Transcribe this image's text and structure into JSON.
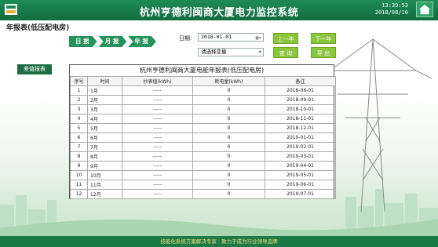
{
  "header": {
    "title": "杭州亨德利闽商大厦电力监控系统",
    "time": "13:39:53",
    "date": "2018/08/10"
  },
  "page_title": "年报表(低压配电房)",
  "nav_tabs": [
    "日 报",
    "月 报",
    "年 报"
  ],
  "filters": {
    "date_label": "日期:",
    "date_value": "2018-01-01",
    "select_value": "请选择变量",
    "prev_year": "上一年",
    "next_year": "下一年",
    "query": "查 询",
    "export": "导 出"
  },
  "diff_button": "差值报表",
  "report": {
    "title": "杭州亨德利闽商大厦电能年报表(低压配电房)",
    "columns": [
      "序号",
      "时间",
      "抄表值(kWh)",
      "耗电量(kWh)",
      "备注"
    ],
    "rows": [
      [
        "1",
        "1月",
        "-----",
        "0",
        "2018-08-01"
      ],
      [
        "2",
        "2月",
        "-----",
        "0",
        "2018-09-01"
      ],
      [
        "3",
        "3月",
        "-----",
        "0",
        "2018-10-01"
      ],
      [
        "4",
        "4月",
        "-----",
        "0",
        "2018-11-01"
      ],
      [
        "5",
        "5月",
        "-----",
        "0",
        "2018-12-01"
      ],
      [
        "6",
        "6月",
        "-----",
        "0",
        "2019-01-01"
      ],
      [
        "7",
        "7月",
        "-----",
        "0",
        "2019-02-01"
      ],
      [
        "8",
        "8月",
        "-----",
        "0",
        "2019-03-01"
      ],
      [
        "9",
        "9月",
        "-----",
        "0",
        "2019-04-01"
      ],
      [
        "10",
        "10月",
        "-----",
        "0",
        "2019-05-01"
      ],
      [
        "11",
        "11月",
        "-----",
        "0",
        "2019-06-01"
      ],
      [
        "12",
        "12月",
        "-----",
        "0",
        "2019-07-01"
      ]
    ]
  },
  "footer": "技能化系统方案解决专家 · 致力于成为行业领导品牌",
  "colors": {
    "header_green": "#1e8c55",
    "button_green": "#8cc63f",
    "dark_green": "#1f6e43"
  }
}
